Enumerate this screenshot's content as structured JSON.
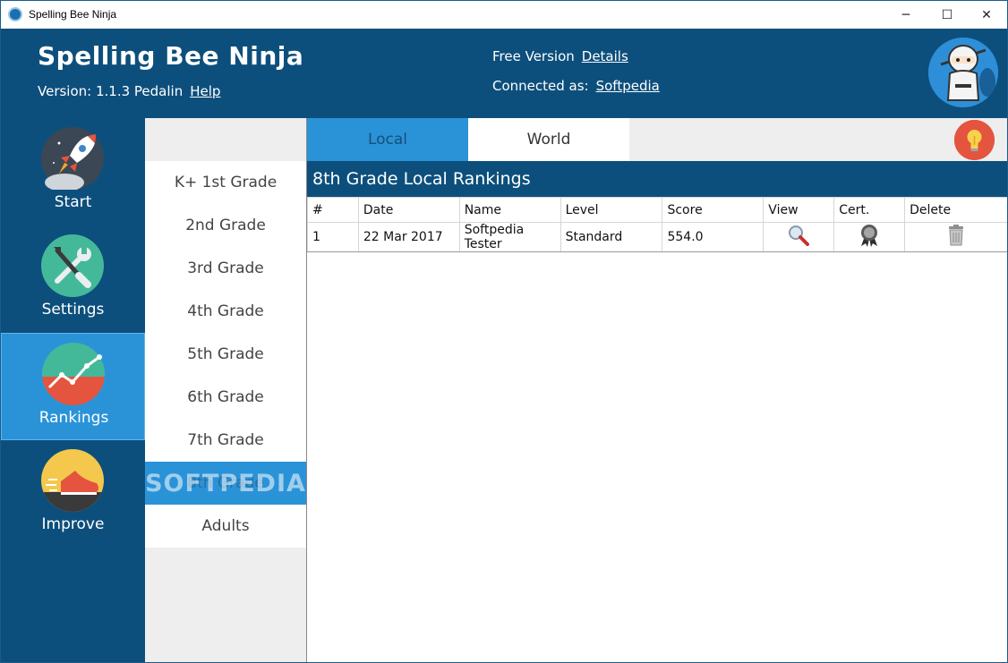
{
  "window": {
    "title": "Spelling Bee Ninja",
    "controls": {
      "minimize": "─",
      "maximize": "☐",
      "close": "✕"
    }
  },
  "header": {
    "app_name": "Spelling Bee Ninja",
    "version_label": "Version: 1.1.3 Pedalin",
    "help_link": "Help",
    "free_version_label": "Free Version",
    "details_link": "Details",
    "connected_label": "Connected as:",
    "user_link": "Softpedia",
    "avatar_icon": "ninja-icon"
  },
  "sidebar": {
    "items": [
      {
        "label": "Start",
        "icon": "rocket-icon",
        "active": false
      },
      {
        "label": "Settings",
        "icon": "tools-icon",
        "active": false
      },
      {
        "label": "Rankings",
        "icon": "chart-icon",
        "active": true
      },
      {
        "label": "Improve",
        "icon": "shoe-icon",
        "active": false
      }
    ]
  },
  "grades": {
    "items": [
      "K+ 1st Grade",
      "2nd Grade",
      "3rd Grade",
      "4th Grade",
      "5th Grade",
      "6th Grade",
      "7th Grade",
      "8th Grade",
      "Adults"
    ],
    "selected": "8th Grade",
    "watermark": "SOFTPEDIA"
  },
  "tabs": {
    "local": "Local",
    "world": "World",
    "active": "Local"
  },
  "hint_icon": "lightbulb-icon",
  "rankings": {
    "title": "8th Grade Local Rankings",
    "columns": [
      "#",
      "Date",
      "Name",
      "Level",
      "Score",
      "View",
      "Cert.",
      "Delete"
    ],
    "rows": [
      {
        "rank": "1",
        "date": "22 Mar 2017",
        "name": "Softpedia Tester",
        "level": "Standard",
        "score": "554.0",
        "view_icon": "magnifier-icon",
        "cert_icon": "award-icon",
        "delete_icon": "trash-icon"
      }
    ]
  },
  "colors": {
    "header_bg": "#0d4f7c",
    "active_blue": "#2a93d8",
    "panel_gray": "#eeeeee",
    "bulb_red": "#e4543f"
  }
}
